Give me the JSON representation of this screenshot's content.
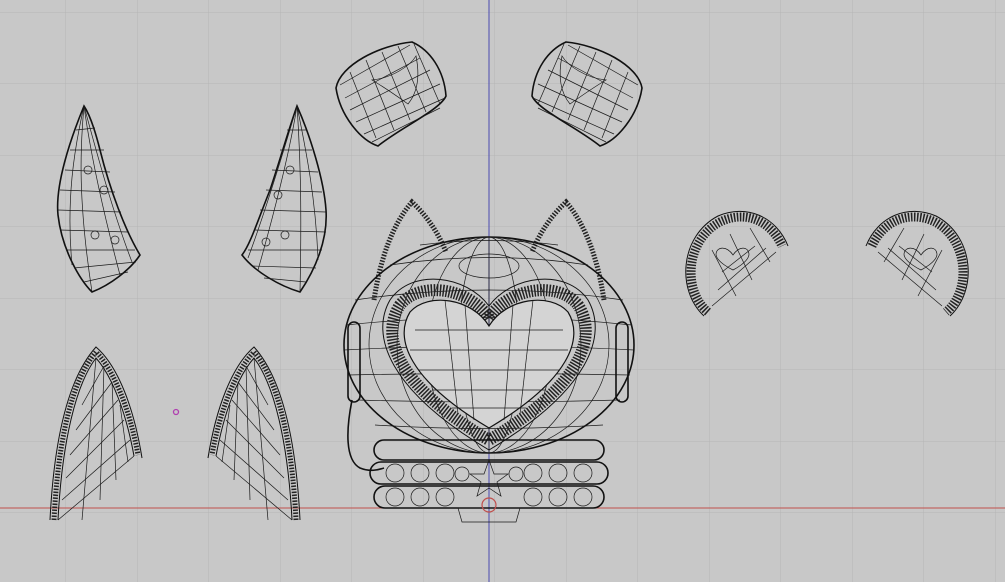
{
  "viewport": {
    "view": "front-orthographic",
    "display_mode": "wireframe",
    "background_color": "#c8c8c8",
    "grid_color": "#b4b4b4",
    "wire_color": "#1a1a1a",
    "x_axis_color": "#c0504d",
    "y_axis_color": "#4a4ab0",
    "point_marker_color": "#b040b0"
  },
  "objects": [
    "ear-inner-left",
    "ear-inner-right",
    "earmuff-cap-left",
    "earmuff-cap-right",
    "ear-outer-left",
    "ear-outer-right",
    "helmet-body",
    "visor-arc-left",
    "visor-arc-right"
  ]
}
